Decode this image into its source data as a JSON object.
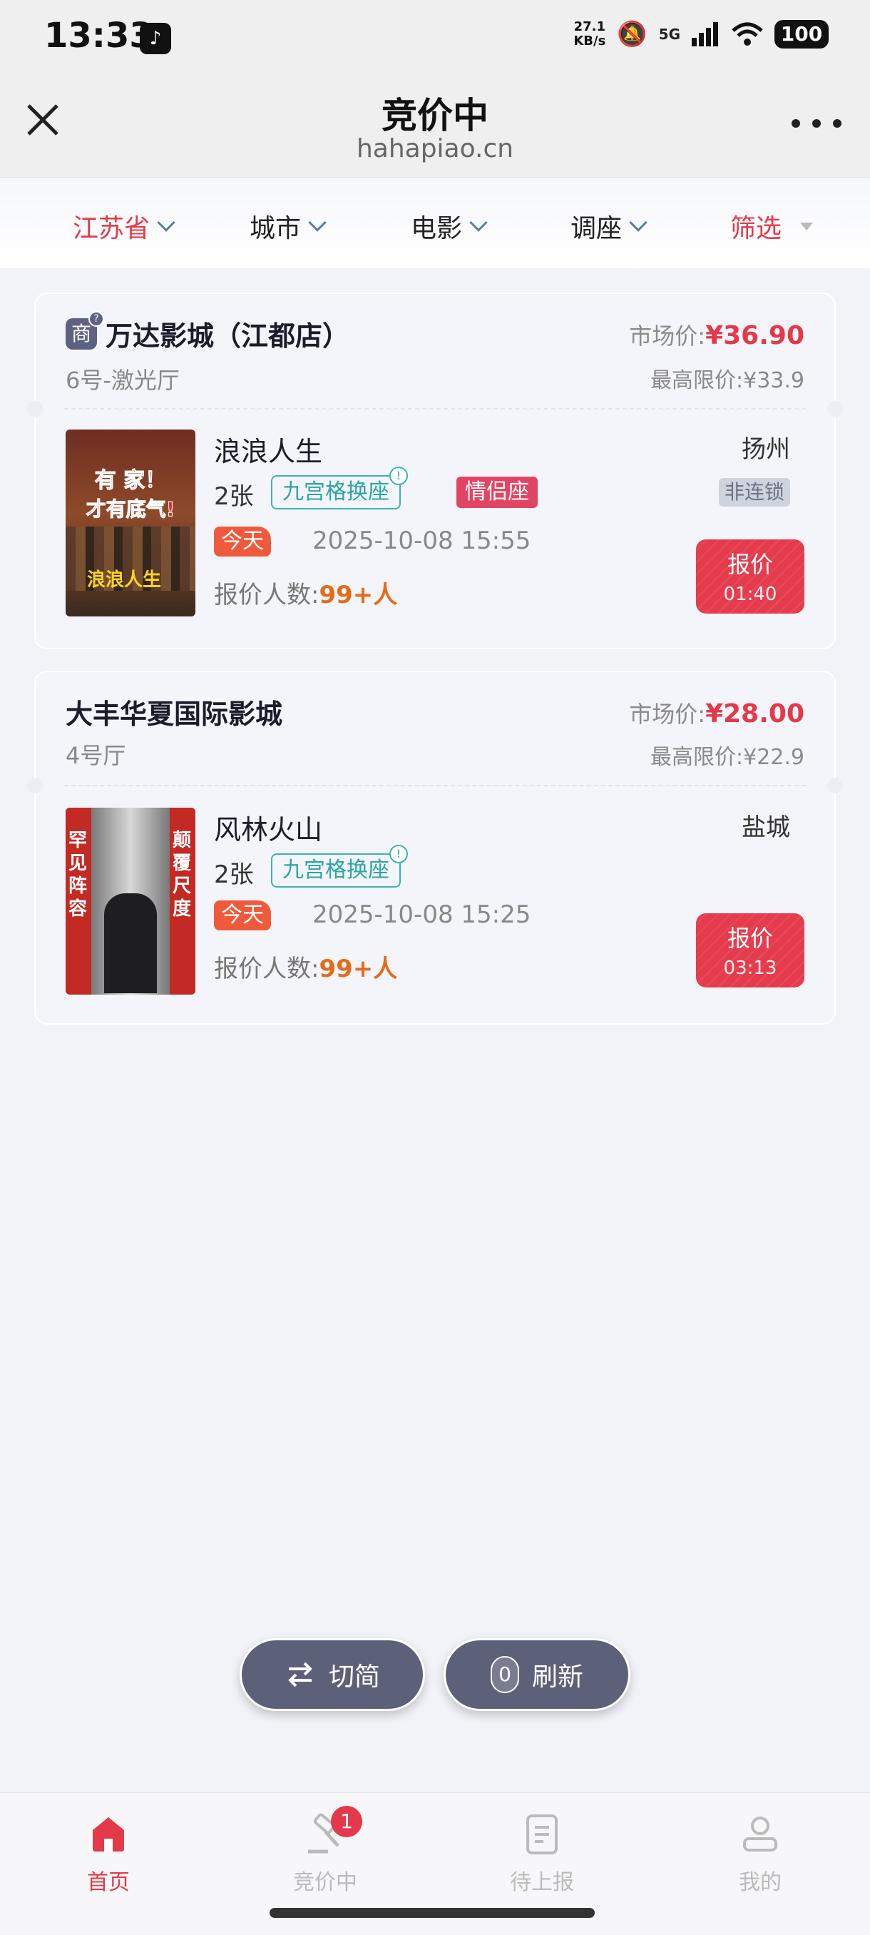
{
  "status": {
    "time": "13:33",
    "net_speed": "27.1",
    "net_unit": "KB/s",
    "network": "5G",
    "battery": "100"
  },
  "header": {
    "title": "竞价中",
    "domain": "hahapiao.cn"
  },
  "filters": {
    "province": "江苏省",
    "city": "城市",
    "movie": "电影",
    "seat_adjust": "调座",
    "filter": "筛选"
  },
  "orders": [
    {
      "shop_badge": "商",
      "shop_badge_hint": "?",
      "cinema": "万达影城（江都店）",
      "hall": "6号-激光厅",
      "market_label": "市场价:",
      "market_price": "¥36.90",
      "limit_label": "最高限价:",
      "limit_price": "¥33.9",
      "movie": "浪浪人生",
      "city": "扬州",
      "tickets": "2张",
      "seat_tag": "九宫格换座",
      "couple_tag": "情侣座",
      "chain_tag": "非连锁",
      "today": "今天",
      "datetime": "2025-10-08 15:55",
      "bidders_label": "报价人数:",
      "bidders": "99+人",
      "bid_label": "报价",
      "countdown": "01:40",
      "poster_text_1": "有 家！",
      "poster_text_2": "才有底气!",
      "poster_text_3": "浪浪人生"
    },
    {
      "cinema": "大丰华夏国际影城",
      "hall": "4号厅",
      "market_label": "市场价:",
      "market_price": "¥28.00",
      "limit_label": "最高限价:",
      "limit_price": "¥22.9",
      "movie": "风林火山",
      "city": "盐城",
      "tickets": "2张",
      "seat_tag": "九宫格换座",
      "today": "今天",
      "datetime": "2025-10-08 15:25",
      "bidders_label": "报价人数:",
      "bidders": "99+人",
      "bid_label": "报价",
      "countdown": "03:13",
      "poster_text_1": "罕见阵容",
      "poster_text_2": "颠覆尺度"
    }
  ],
  "floating": {
    "switch_label": "切简",
    "refresh_count": "0",
    "refresh_label": "刷新"
  },
  "tabs": {
    "home": "首页",
    "bidding": "竞价中",
    "bidding_badge": "1",
    "pending": "待上报",
    "mine": "我的"
  },
  "colors": {
    "accent": "#e4394a",
    "tag_teal": "#3ab4b0",
    "dark_button": "#5d6079"
  }
}
